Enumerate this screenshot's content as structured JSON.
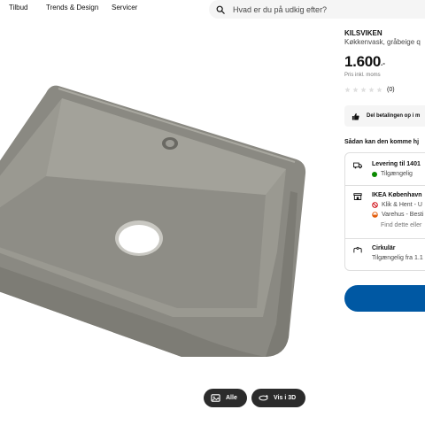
{
  "nav": {
    "items": [
      "Tilbud",
      "Trends & Design",
      "Servicer"
    ]
  },
  "search": {
    "placeholder": "Hvad er du på udkig efter?"
  },
  "gallery": {
    "buttons": {
      "all": "Alle",
      "view3d": "Vis i 3D"
    }
  },
  "product": {
    "name": "KILSVIKEN",
    "description": "Køkkenvask, gråbeige q",
    "price": "1.600",
    "price_suffix": ".-",
    "price_note": "Pris inkl. moms",
    "rating": 0,
    "review_count": "(0)",
    "payment_banner": "Del betalingen op i m"
  },
  "delivery": {
    "heading": "Sådan kan den komme hj",
    "rows": [
      {
        "title": "Levering til 1401",
        "status": "Tilgængelig",
        "status_color": "#0a8a00"
      },
      {
        "title": "IKEA København",
        "lines": [
          "Klik & Hent - U",
          "Varehus - Besti",
          "Find dette eller"
        ]
      },
      {
        "title": "Cirkulär",
        "status": "Tilgængelig fra 1.1"
      }
    ]
  },
  "colors": {
    "accent": "#0058a3",
    "available": "#0a8a00",
    "unavailable": "#cc0008",
    "store_orange": "#e35d0c",
    "sink": "#8a8982"
  }
}
